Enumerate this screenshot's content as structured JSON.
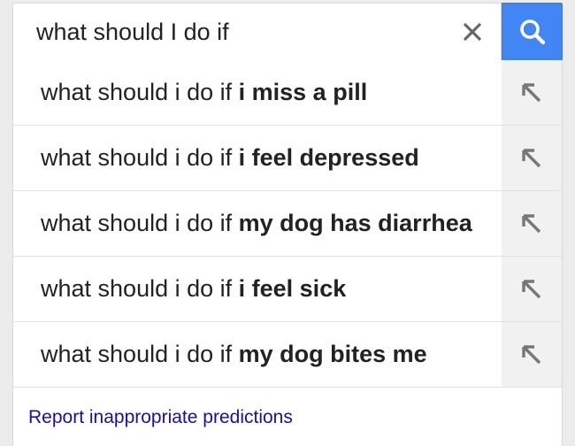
{
  "search": {
    "query": "what should I do if"
  },
  "icons": {
    "clear": "close-icon",
    "search": "search-icon",
    "fill": "arrow-up-left-icon"
  },
  "colors": {
    "search_button": "#4285f4",
    "link": "#1a0dab",
    "text": "#222222"
  },
  "suggestions": [
    {
      "prefix": "what should i do if ",
      "completion": "i miss a pill"
    },
    {
      "prefix": "what should i do if ",
      "completion": "i feel depressed"
    },
    {
      "prefix": "what should i do if ",
      "completion": "my dog has diarrhea"
    },
    {
      "prefix": "what should i do if ",
      "completion": "i feel sick"
    },
    {
      "prefix": "what should i do if ",
      "completion": "my dog bites me"
    }
  ],
  "footer": {
    "report_label": "Report inappropriate predictions"
  }
}
